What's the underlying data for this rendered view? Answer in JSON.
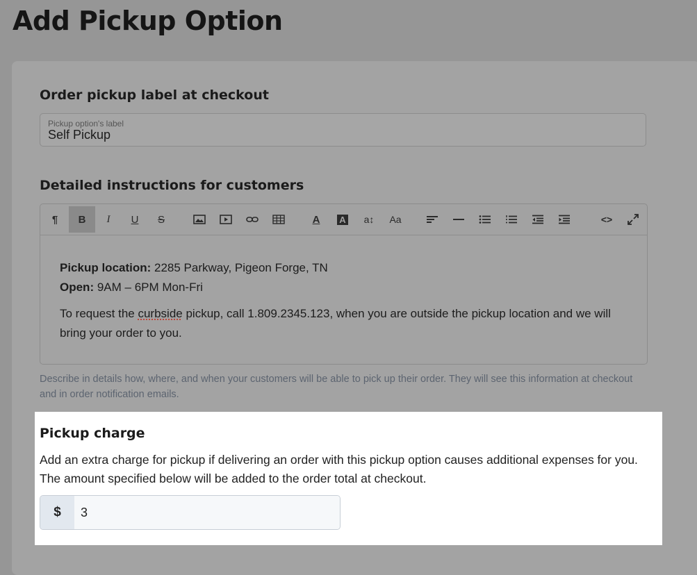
{
  "page": {
    "title": "Add Pickup Option"
  },
  "label_section": {
    "title": "Order pickup label at checkout",
    "field_label": "Pickup option's label",
    "field_value": "Self Pickup"
  },
  "instructions_section": {
    "title": "Detailed instructions for customers",
    "toolbar": {
      "buttons": [
        {
          "name": "paragraph",
          "glyph": "¶"
        },
        {
          "name": "bold",
          "glyph": "B",
          "active": true
        },
        {
          "name": "italic",
          "glyph": "I"
        },
        {
          "name": "underline",
          "glyph": "U"
        },
        {
          "name": "strikethrough",
          "glyph": "S"
        },
        {
          "name": "image",
          "glyph": ""
        },
        {
          "name": "video",
          "glyph": ""
        },
        {
          "name": "link",
          "glyph": ""
        },
        {
          "name": "table",
          "glyph": ""
        },
        {
          "name": "text-color",
          "glyph": "A"
        },
        {
          "name": "background-color",
          "glyph": "A"
        },
        {
          "name": "line-height",
          "glyph": "a↕"
        },
        {
          "name": "font-size",
          "glyph": "Aa"
        },
        {
          "name": "align",
          "glyph": ""
        },
        {
          "name": "horizontal-rule",
          "glyph": ""
        },
        {
          "name": "bullet-list",
          "glyph": ""
        },
        {
          "name": "numbered-list",
          "glyph": ""
        },
        {
          "name": "outdent",
          "glyph": ""
        },
        {
          "name": "indent",
          "glyph": ""
        },
        {
          "name": "code-view",
          "glyph": "<>"
        },
        {
          "name": "fullscreen",
          "glyph": ""
        }
      ]
    },
    "content": {
      "location_label": "Pickup location:",
      "location_value": " 2285 Parkway, Pigeon Forge, TN",
      "open_label": "Open:",
      "open_value": " 9AM – 6PM Mon-Fri",
      "para_before": "To request the ",
      "para_misspelled": "curbside",
      "para_after": " pickup, call 1.809.2345.123, when you are outside the pickup location and we will bring your order to you."
    },
    "hint": "Describe in details how, where, and when your customers will be able to pick up their order. They will see this information at checkout and in order notification emails."
  },
  "charge_section": {
    "title": "Pickup charge",
    "description": "Add an extra charge for pickup if delivering an order with this pickup option causes additional expenses for you. The amount specified below will be added to the order total at checkout.",
    "currency": "$",
    "amount": "3"
  }
}
